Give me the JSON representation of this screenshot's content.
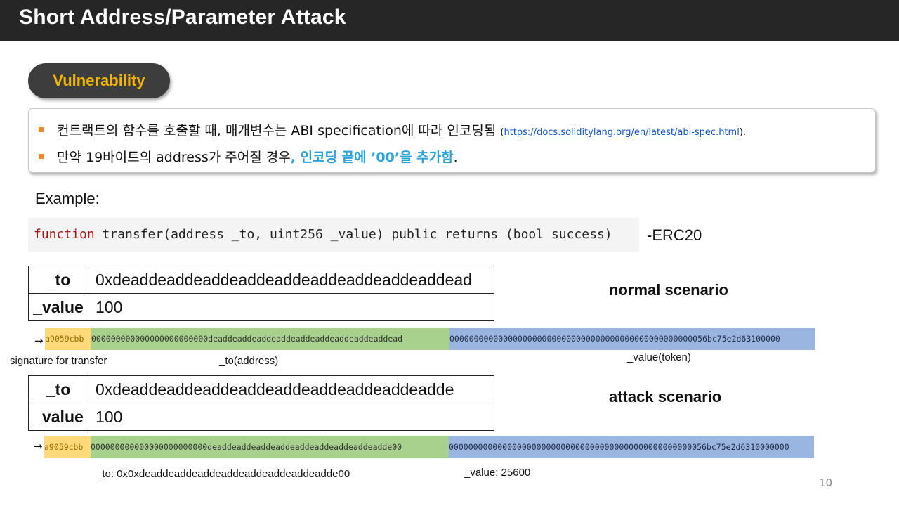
{
  "slide": {
    "title": "Short Address/Parameter Attack",
    "page_number": "10"
  },
  "vulnerability": {
    "label": "Vulnerability",
    "bullet1_text": "컨트랙트의 함수를 호출할 때, 매개변수는 ABI specification에 따라 인코딩됨 ",
    "bullet1_link_open": "(",
    "bullet1_link": "https://docs.soliditylang.org/en/latest/abi-spec.html",
    "bullet1_link_close": ").",
    "bullet2_text": "만약 19바이트의 address가 주어질 경우",
    "bullet2_highlight": ", 인코딩 끝에 ’00’을 추가함",
    "bullet2_end": "."
  },
  "example": {
    "label": "Example:",
    "code_keyword": "function",
    "code_rest": " transfer(address _to, uint256 _value) public returns (bool success)",
    "code_suffix": "-ERC20"
  },
  "normal": {
    "scenario_label": "normal scenario",
    "rows": [
      {
        "key": "_to",
        "value": "0xdeaddeaddeaddeaddeaddeaddeaddeaddeaddead"
      },
      {
        "key": "_value",
        "value": "100"
      }
    ],
    "arrow": "→",
    "encoded_sig": "a9059cbb",
    "encoded_to": "000000000000000000000000deaddeaddeaddeaddeaddeaddeaddeaddeaddead",
    "encoded_value": "00000000000000000000000000000000000000000000000000056bc75e2d63100000",
    "caption_sig": "signature for transfer",
    "caption_to": "_to(address)",
    "caption_value": "_value(token)"
  },
  "attack": {
    "scenario_label": "attack scenario",
    "rows": [
      {
        "key": "_to",
        "value": "0xdeaddeaddeaddeaddeaddeaddeaddeaddeadde"
      },
      {
        "key": "_value",
        "value": "100"
      }
    ],
    "arrow": "→",
    "encoded_sig": "a9059cbb",
    "encoded_to": "000000000000000000000000deaddeaddeaddeaddeaddeaddeaddeaddeadde00",
    "encoded_value": "00000000000000000000000000000000000000000000000000056bc75e2d6310000000",
    "caption_to": "_to: 0x0xdeaddeaddeaddeaddeaddeaddeaddeadde00",
    "caption_value": "_value: 25600"
  }
}
